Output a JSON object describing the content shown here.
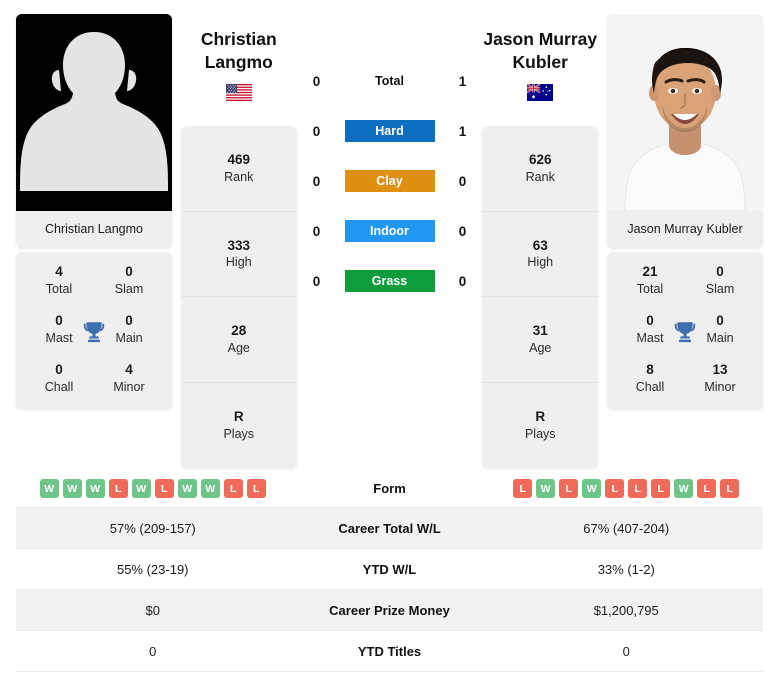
{
  "players": {
    "left": {
      "name_full": "Christian Langmo",
      "name_line1": "Christian",
      "name_line2": "Langmo",
      "country": "USA",
      "flag_icon": "flag-usa-icon",
      "photo_type": "placeholder-silhouette",
      "stats": [
        {
          "value": "469",
          "label": "Rank"
        },
        {
          "value": "333",
          "label": "High"
        },
        {
          "value": "28",
          "label": "Age"
        },
        {
          "value": "R",
          "label": "Plays"
        }
      ],
      "titles": [
        {
          "value": "4",
          "label": "Total"
        },
        {
          "value": "0",
          "label": "Slam"
        },
        {
          "value": "0",
          "label": "Mast"
        },
        {
          "value": "0",
          "label": "Main"
        },
        {
          "value": "0",
          "label": "Chall"
        },
        {
          "value": "4",
          "label": "Minor"
        }
      ],
      "form": [
        "W",
        "W",
        "W",
        "L",
        "W",
        "L",
        "W",
        "W",
        "L",
        "L"
      ]
    },
    "right": {
      "name_full": "Jason Murray Kubler",
      "name_line1": "Jason Murray",
      "name_line2": "Kubler",
      "country": "AUS",
      "flag_icon": "flag-australia-icon",
      "photo_type": "portrait",
      "stats": [
        {
          "value": "626",
          "label": "Rank"
        },
        {
          "value": "63",
          "label": "High"
        },
        {
          "value": "31",
          "label": "Age"
        },
        {
          "value": "R",
          "label": "Plays"
        }
      ],
      "titles": [
        {
          "value": "21",
          "label": "Total"
        },
        {
          "value": "0",
          "label": "Slam"
        },
        {
          "value": "0",
          "label": "Mast"
        },
        {
          "value": "0",
          "label": "Main"
        },
        {
          "value": "8",
          "label": "Chall"
        },
        {
          "value": "13",
          "label": "Minor"
        }
      ],
      "form": [
        "L",
        "W",
        "L",
        "W",
        "L",
        "L",
        "L",
        "W",
        "L",
        "L"
      ]
    }
  },
  "h2h": [
    {
      "label": "Total",
      "left": "0",
      "right": "1",
      "style": "plain",
      "color": ""
    },
    {
      "label": "Hard",
      "left": "0",
      "right": "1",
      "style": "badge",
      "color": "#0b6ebe"
    },
    {
      "label": "Clay",
      "left": "0",
      "right": "0",
      "style": "badge",
      "color": "#e09010"
    },
    {
      "label": "Indoor",
      "left": "0",
      "right": "0",
      "style": "badge",
      "color": "#2196f3"
    },
    {
      "label": "Grass",
      "left": "0",
      "right": "0",
      "style": "badge",
      "color": "#0e9c3d"
    }
  ],
  "table": [
    {
      "label": "Form",
      "left": "",
      "right": "",
      "type": "form",
      "shade": false
    },
    {
      "label": "Career Total W/L",
      "left": "57% (209-157)",
      "right": "67% (407-204)",
      "type": "text",
      "shade": true
    },
    {
      "label": "YTD W/L",
      "left": "55% (23-19)",
      "right": "33% (1-2)",
      "type": "text",
      "shade": false
    },
    {
      "label": "Career Prize Money",
      "left": "$0",
      "right": "$1,200,795",
      "type": "text",
      "shade": true
    },
    {
      "label": "YTD Titles",
      "left": "0",
      "right": "0",
      "type": "text",
      "shade": false
    }
  ],
  "colors": {
    "win": "#6fc48a",
    "loss": "#f06a5a",
    "trophy": "#3e6ead",
    "card_bg": "#efefef",
    "row_shade": "#f2f2f2"
  }
}
